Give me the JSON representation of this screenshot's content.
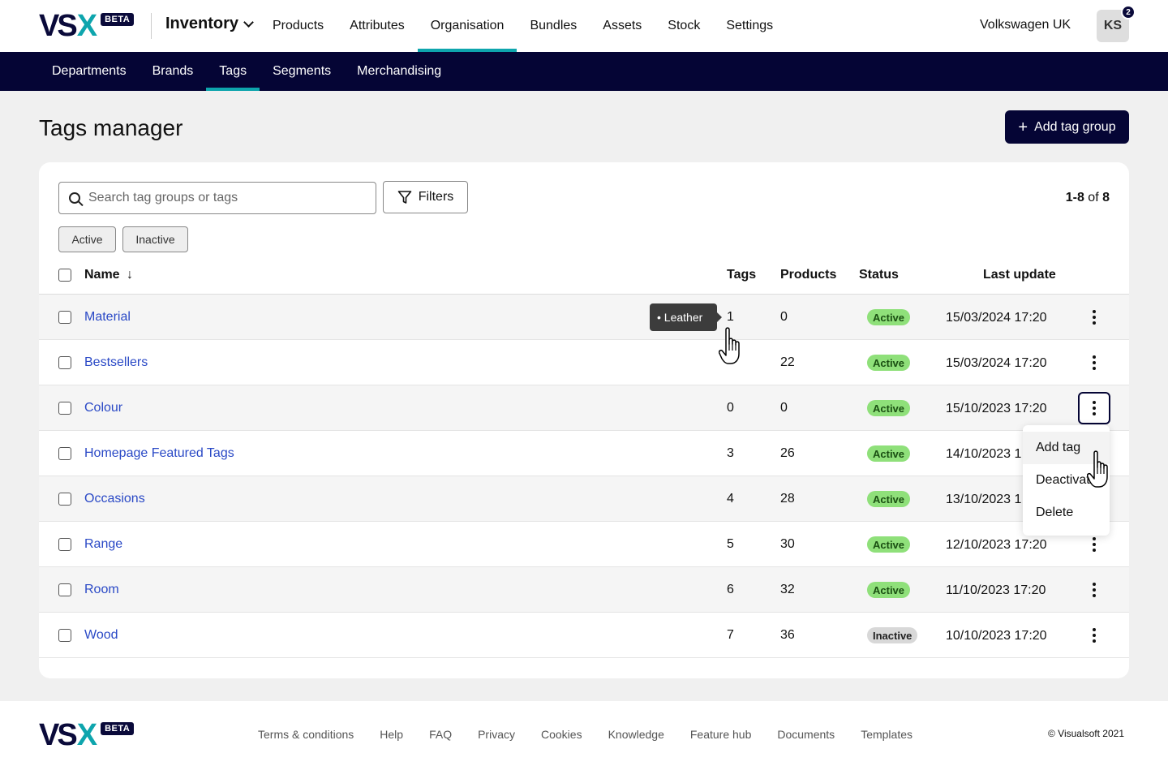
{
  "brand": {
    "logo_text_v": "VS",
    "logo_text_x": "X",
    "badge": "BETA"
  },
  "header": {
    "app_name": "Inventory",
    "nav": [
      "Products",
      "Attributes",
      "Organisation",
      "Bundles",
      "Assets",
      "Stock",
      "Settings"
    ],
    "active_nav": "Organisation",
    "org_name": "Volkswagen UK",
    "avatar_initials": "KS",
    "notification_count": "2"
  },
  "subnav": {
    "items": [
      "Departments",
      "Brands",
      "Tags",
      "Segments",
      "Merchandising"
    ],
    "active": "Tags"
  },
  "page": {
    "title": "Tags manager",
    "add_button": "Add tag group",
    "add_button_icon": "+"
  },
  "toolbar": {
    "search_placeholder": "Search tag groups or tags",
    "filters_label": "Filters",
    "count_range": "1-8",
    "count_of": "of",
    "count_total": "8",
    "chips": [
      "Active",
      "Inactive"
    ]
  },
  "table": {
    "columns": {
      "name": "Name",
      "tags": "Tags",
      "products": "Products",
      "status": "Status",
      "last_update": "Last update"
    },
    "sort_indicator": "↓",
    "rows": [
      {
        "name": "Material",
        "tags": "1",
        "products": "0",
        "status": "Active",
        "last_update": "15/03/2024 17:20"
      },
      {
        "name": "Bestsellers",
        "tags": "",
        "products": "22",
        "status": "Active",
        "last_update": "15/03/2024 17:20"
      },
      {
        "name": "Colour",
        "tags": "0",
        "products": "0",
        "status": "Active",
        "last_update": "15/10/2023 17:20"
      },
      {
        "name": "Homepage Featured Tags",
        "tags": "3",
        "products": "26",
        "status": "Active",
        "last_update": "14/10/2023 1"
      },
      {
        "name": "Occasions",
        "tags": "4",
        "products": "28",
        "status": "Active",
        "last_update": "13/10/2023 1"
      },
      {
        "name": "Range",
        "tags": "5",
        "products": "30",
        "status": "Active",
        "last_update": "12/10/2023 17:20"
      },
      {
        "name": "Room",
        "tags": "6",
        "products": "32",
        "status": "Active",
        "last_update": "11/10/2023 17:20"
      },
      {
        "name": "Wood",
        "tags": "7",
        "products": "36",
        "status": "Inactive",
        "last_update": "10/10/2023 17:20"
      }
    ]
  },
  "tooltip": {
    "text": "• Leather"
  },
  "row_menu": {
    "items": [
      "Add tag",
      "Deactivat",
      "Delete"
    ]
  },
  "footer": {
    "links": [
      "Terms & conditions",
      "Help",
      "FAQ",
      "Privacy",
      "Cookies",
      "Knowledge",
      "Feature hub",
      "Documents",
      "Templates"
    ],
    "copyright": "© Visualsoft 2021"
  },
  "colors": {
    "navy": "#050535",
    "teal": "#0ea5ad",
    "link": "#2a49c6",
    "active_badge": "#8fe07a"
  }
}
